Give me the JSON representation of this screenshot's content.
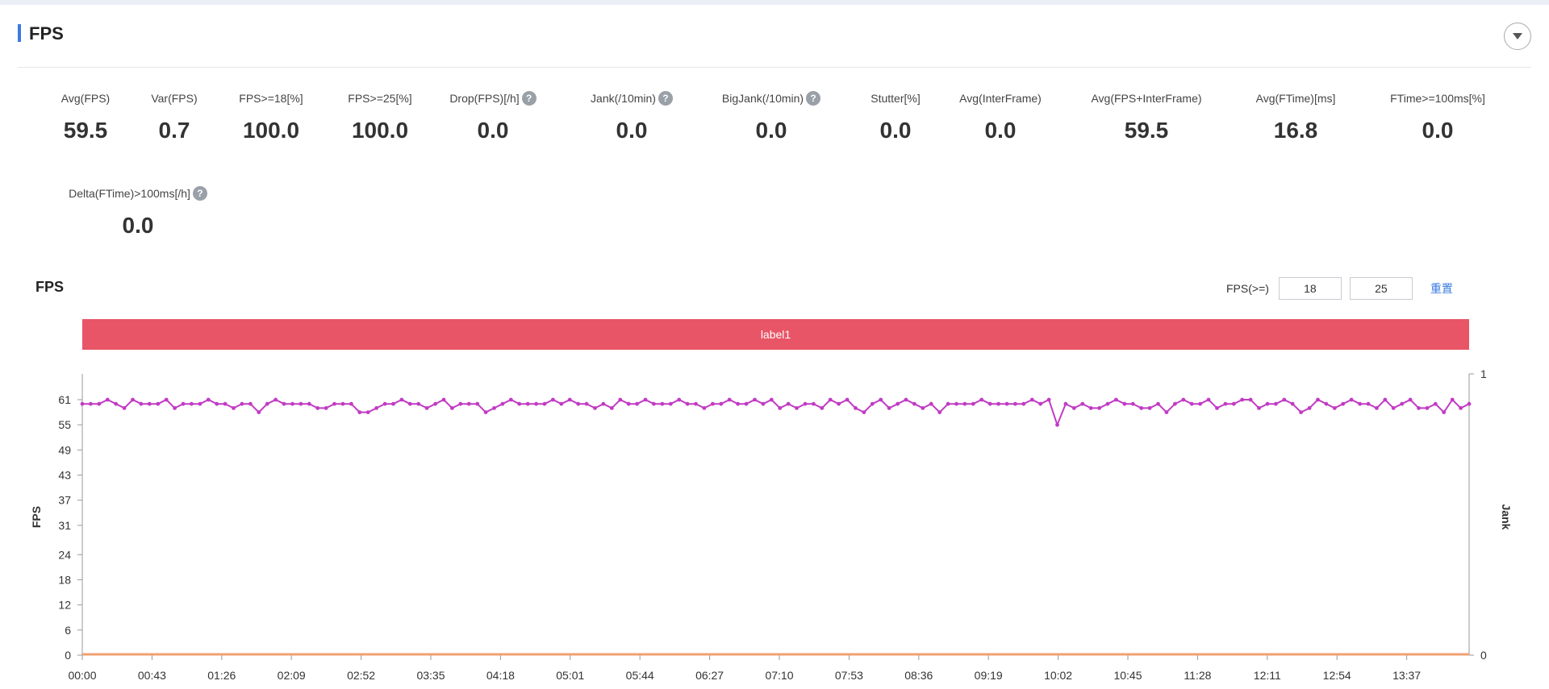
{
  "header": {
    "title": "FPS"
  },
  "metrics": [
    {
      "label": "Avg(FPS)",
      "value": "59.5",
      "help": false
    },
    {
      "label": "Var(FPS)",
      "value": "0.7",
      "help": false
    },
    {
      "label": "FPS>=18[%]",
      "value": "100.0",
      "help": false
    },
    {
      "label": "FPS>=25[%]",
      "value": "100.0",
      "help": false
    },
    {
      "label": "Drop(FPS)[/h]",
      "value": "0.0",
      "help": true
    },
    {
      "label": "Jank(/10min)",
      "value": "0.0",
      "help": true
    },
    {
      "label": "BigJank(/10min)",
      "value": "0.0",
      "help": true
    },
    {
      "label": "Stutter[%]",
      "value": "0.0",
      "help": false
    },
    {
      "label": "Avg(InterFrame)",
      "value": "0.0",
      "help": false
    },
    {
      "label": "Avg(FPS+InterFrame)",
      "value": "59.5",
      "help": false
    },
    {
      "label": "Avg(FTime)[ms]",
      "value": "16.8",
      "help": false
    },
    {
      "label": "FTime>=100ms[%]",
      "value": "0.0",
      "help": false
    },
    {
      "label": "Delta(FTime)>100ms[/h]",
      "value": "0.0",
      "help": true
    }
  ],
  "help_glyph": "?",
  "chart_section": {
    "title": "FPS",
    "threshold_label": "FPS(>=)",
    "threshold_low": "18",
    "threshold_high": "25",
    "reset_label": "重置",
    "label_bar": "label1"
  },
  "colors": {
    "accent": "#3b7be0",
    "label_bar": "#e85566",
    "fps_series": "#c13bc4",
    "jank_series": "#f0a070"
  },
  "chart_data": {
    "type": "line",
    "ylabel": "FPS",
    "y2label": "Jank",
    "yticks": [
      0,
      6,
      12,
      18,
      24,
      31,
      37,
      43,
      49,
      55,
      61
    ],
    "ylim": [
      0,
      66
    ],
    "y2ticks": [
      0,
      1
    ],
    "y2lim": [
      0,
      1
    ],
    "xticks": [
      "00:00",
      "00:43",
      "01:26",
      "02:09",
      "02:52",
      "03:35",
      "04:18",
      "05:01",
      "05:44",
      "06:27",
      "07:10",
      "07:53",
      "08:36",
      "09:19",
      "10:02",
      "10:45",
      "11:28",
      "12:11",
      "12:54",
      "13:37"
    ],
    "x_range_seconds": [
      0,
      860
    ],
    "series": [
      {
        "values": [
          60,
          60,
          60,
          61,
          60,
          59,
          61,
          60,
          60,
          60,
          61,
          59,
          60,
          60,
          60,
          61,
          60,
          60,
          59,
          60,
          60,
          58,
          60,
          61,
          60,
          60,
          60,
          60,
          59,
          59,
          60,
          60,
          60,
          58,
          58,
          59,
          60,
          60,
          61,
          60,
          60,
          59,
          60,
          61,
          59,
          60,
          60,
          60,
          58,
          59,
          60,
          61,
          60,
          60,
          60,
          60,
          61,
          60,
          61,
          60,
          60,
          59,
          60,
          59,
          61,
          60,
          60,
          61,
          60,
          60,
          60,
          61,
          60,
          60,
          59,
          60,
          60,
          61,
          60,
          60,
          61,
          60,
          61,
          59,
          60,
          59,
          60,
          60,
          59,
          61,
          60,
          61,
          59,
          58,
          60,
          61,
          59,
          60,
          61,
          60,
          59,
          60,
          58,
          60,
          60,
          60,
          60,
          61,
          60,
          60,
          60,
          60,
          60,
          61,
          60,
          61,
          55,
          60,
          59,
          60,
          59,
          59,
          60,
          61,
          60,
          60,
          59,
          59,
          60,
          58,
          60,
          61,
          60,
          60,
          61,
          59,
          60,
          60,
          61,
          61,
          59,
          60,
          60,
          61,
          60,
          58,
          59,
          61,
          60,
          59,
          60,
          61,
          60,
          60,
          59,
          61,
          59,
          60,
          61,
          59,
          59,
          60,
          58,
          61,
          59,
          60
        ]
      },
      {
        "name": "Jank",
        "values": [
          0,
          0
        ]
      }
    ]
  }
}
